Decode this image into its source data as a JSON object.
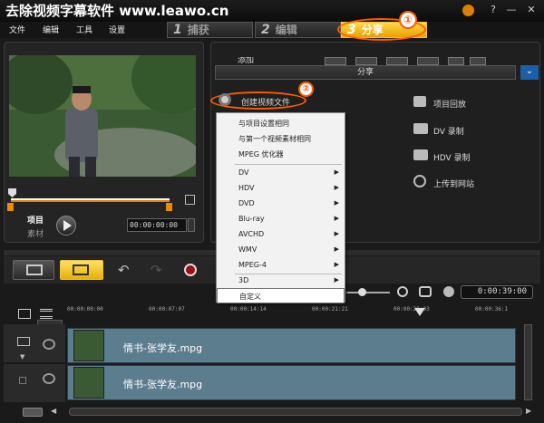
{
  "window": {
    "title": "去除视频字幕软件 www.leawo.cn"
  },
  "menu": [
    "文件",
    "编辑",
    "工具",
    "设置"
  ],
  "steps": [
    {
      "num": "1",
      "label": "捕获"
    },
    {
      "num": "2",
      "label": "编辑"
    },
    {
      "num": "3",
      "label": "分享"
    }
  ],
  "callouts": {
    "one": "①",
    "two": "②"
  },
  "preview": {
    "project_label": "项目",
    "clip_label": "素材",
    "timecode": "00:00:00:00"
  },
  "share": {
    "header": "分享",
    "create_video": "创建视频文件",
    "project_playback": "项目回放",
    "dv_record": "DV 录制",
    "hdv_record": "HDV 录制",
    "upload": "上传到网站",
    "toolbar_add": "添加"
  },
  "context_menu": [
    {
      "label": "与项目设置相同",
      "arrow": false
    },
    {
      "label": "与第一个视频素材相同",
      "arrow": false
    },
    {
      "label": "MPEG 优化器",
      "arrow": false
    },
    {
      "label": "DV",
      "arrow": true
    },
    {
      "label": "HDV",
      "arrow": true
    },
    {
      "label": "DVD",
      "arrow": true
    },
    {
      "label": "Blu-ray",
      "arrow": true
    },
    {
      "label": "AVCHD",
      "arrow": true
    },
    {
      "label": "WMV",
      "arrow": true
    },
    {
      "label": "MPEG-4",
      "arrow": true
    },
    {
      "label": "3D",
      "arrow": true
    },
    {
      "label": "自定义",
      "arrow": false
    }
  ],
  "timeline": {
    "duration": "0:00:39:00",
    "ticks": [
      "00:00:00:00",
      "00:00:07:07",
      "00:00:14:14",
      "00:00:21:21",
      "00:00:29:03",
      "00:00:36:1"
    ],
    "clips": [
      {
        "name": "情书-张学友.mpg"
      },
      {
        "name": "情书-张学友.mpg"
      }
    ]
  },
  "colors": {
    "accent": "#f2b300",
    "callout": "#ff5a00",
    "track": "#5b7d8e"
  }
}
